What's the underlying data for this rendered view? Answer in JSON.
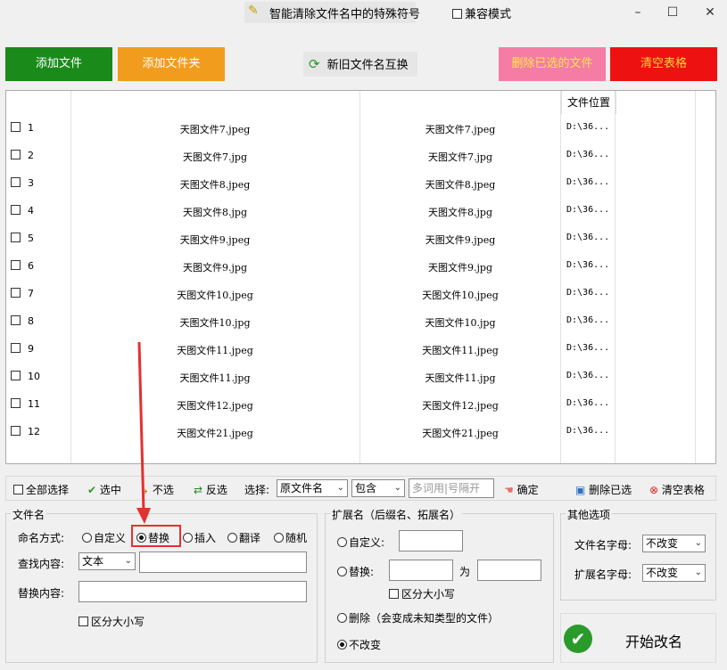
{
  "window": {
    "title": "智能清除文件名中的特殊符号",
    "title_icon": "magic-wand-icon",
    "compat_label": "兼容模式",
    "controls": [
      "–",
      "☐",
      "✕"
    ]
  },
  "top_buttons": {
    "add_file": "添加文件",
    "add_folder": "添加文件夹",
    "swap": "新旧文件名互换",
    "delete_selected": "删除已选的文件",
    "clear_table": "清空表格"
  },
  "table": {
    "location_header": "文件位置",
    "rows": [
      {
        "n": "1",
        "old": "天图文件7.jpeg",
        "new": "天图文件7.jpeg",
        "loc": "D:\\36..."
      },
      {
        "n": "2",
        "old": "天图文件7.jpg",
        "new": "天图文件7.jpg",
        "loc": "D:\\36..."
      },
      {
        "n": "3",
        "old": "天图文件8.jpeg",
        "new": "天图文件8.jpeg",
        "loc": "D:\\36..."
      },
      {
        "n": "4",
        "old": "天图文件8.jpg",
        "new": "天图文件8.jpg",
        "loc": "D:\\36..."
      },
      {
        "n": "5",
        "old": "天图文件9.jpeg",
        "new": "天图文件9.jpeg",
        "loc": "D:\\36..."
      },
      {
        "n": "6",
        "old": "天图文件9.jpg",
        "new": "天图文件9.jpg",
        "loc": "D:\\36..."
      },
      {
        "n": "7",
        "old": "天图文件10.jpeg",
        "new": "天图文件10.jpeg",
        "loc": "D:\\36..."
      },
      {
        "n": "8",
        "old": "天图文件10.jpg",
        "new": "天图文件10.jpg",
        "loc": "D:\\36..."
      },
      {
        "n": "9",
        "old": "天图文件11.jpeg",
        "new": "天图文件11.jpeg",
        "loc": "D:\\36..."
      },
      {
        "n": "10",
        "old": "天图文件11.jpg",
        "new": "天图文件11.jpg",
        "loc": "D:\\36..."
      },
      {
        "n": "11",
        "old": "天图文件12.jpeg",
        "new": "天图文件12.jpeg",
        "loc": "D:\\36..."
      },
      {
        "n": "12",
        "old": "天图文件21.jpeg",
        "new": "天图文件21.jpeg",
        "loc": "D:\\36..."
      }
    ]
  },
  "toolbar": {
    "select_all": "全部选择",
    "check": "选中",
    "uncheck": "不选",
    "invert": "反选",
    "select_label": "选择:",
    "field_value": "原文件名",
    "match_value": "包含",
    "keyword_placeholder": "多词用|号隔开",
    "confirm": "确定",
    "delete_selected": "删除已选",
    "clear_table": "清空表格"
  },
  "filename_group": {
    "title": "文件名",
    "mode_label": "命名方式:",
    "modes": [
      "自定义",
      "替换",
      "插入",
      "翻译",
      "随机"
    ],
    "selected_mode": "替换",
    "find_label": "查找内容:",
    "find_type": "文本",
    "replace_label": "替换内容:",
    "case_label": "区分大小写"
  },
  "ext_group": {
    "title": "扩展名（后缀名、拓展名）",
    "custom_label": "自定义:",
    "replace_label": "替换:",
    "to_label": "为",
    "case_label": "区分大小写",
    "delete_label": "删除（会变成未知类型的文件）",
    "nochange_label": "不改变",
    "selected": "不改变"
  },
  "other_group": {
    "title": "其他选项",
    "filename_case_label": "文件名字母:",
    "filename_case_value": "不改变",
    "ext_case_label": "扩展名字母:",
    "ext_case_value": "不改变"
  },
  "start_button": "开始改名",
  "colors": {
    "add_file": "#1a8a1a",
    "add_folder": "#f29c1e",
    "delete_selected": "#f57ca4",
    "clear_table": "#ee1111",
    "annotation": "#e53030"
  }
}
